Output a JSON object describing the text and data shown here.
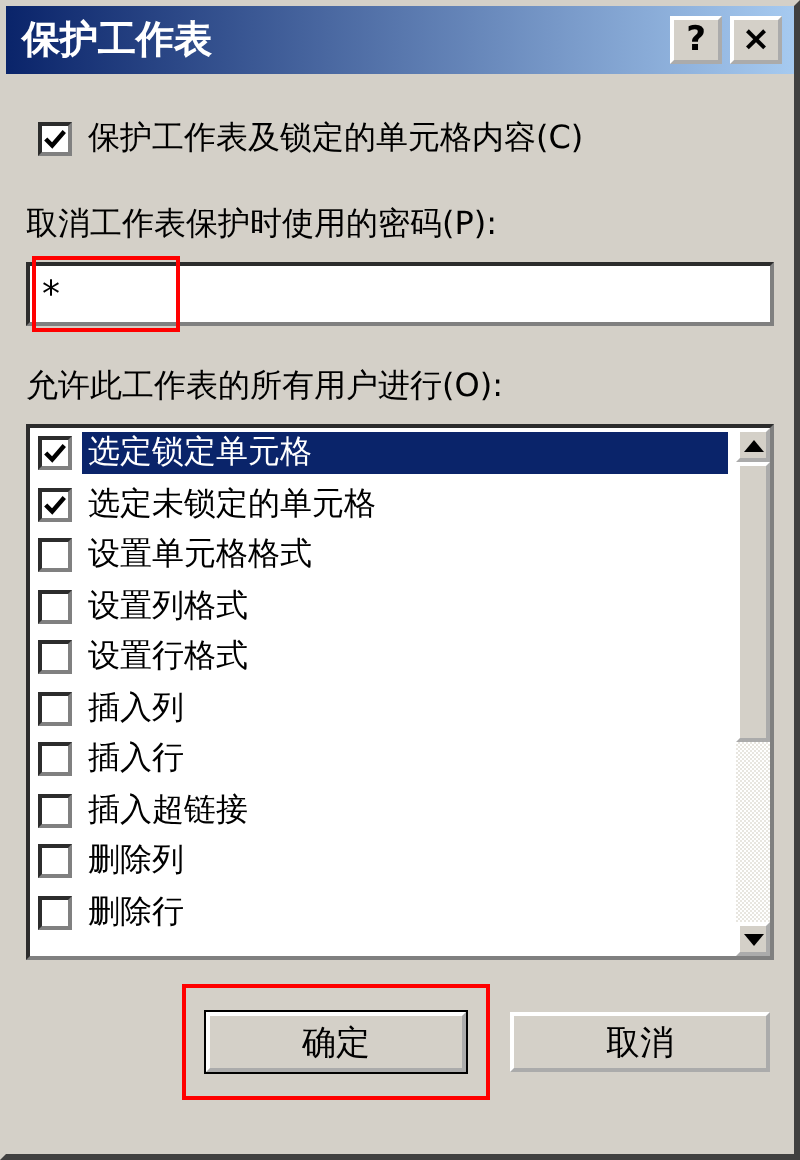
{
  "window": {
    "title": "保护工作表",
    "help_button": "?",
    "close_button": "×"
  },
  "protect_option": {
    "label": "保护工作表及锁定的单元格内容(C)",
    "checked": true
  },
  "password": {
    "label": "取消工作表保护时使用的密码(P):",
    "value": "*"
  },
  "permissions": {
    "label": "允许此工作表的所有用户进行(O):",
    "items": [
      {
        "label": "选定锁定单元格",
        "checked": true,
        "selected": true
      },
      {
        "label": "选定未锁定的单元格",
        "checked": true,
        "selected": false
      },
      {
        "label": "设置单元格格式",
        "checked": false,
        "selected": false
      },
      {
        "label": "设置列格式",
        "checked": false,
        "selected": false
      },
      {
        "label": "设置行格式",
        "checked": false,
        "selected": false
      },
      {
        "label": "插入列",
        "checked": false,
        "selected": false
      },
      {
        "label": "插入行",
        "checked": false,
        "selected": false
      },
      {
        "label": "插入超链接",
        "checked": false,
        "selected": false
      },
      {
        "label": "删除列",
        "checked": false,
        "selected": false
      },
      {
        "label": "删除行",
        "checked": false,
        "selected": false
      }
    ]
  },
  "buttons": [
    {
      "label": "确定",
      "highlighted": true
    },
    {
      "label": "取消",
      "highlighted": false
    }
  ],
  "annotations": {
    "password_highlight": true
  }
}
